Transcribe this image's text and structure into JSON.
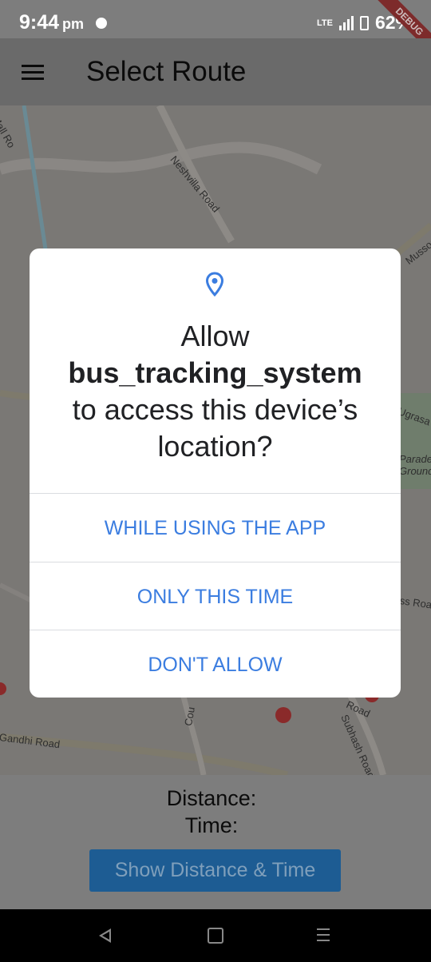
{
  "status_bar": {
    "time": "9:44",
    "ampm": "pm",
    "network": "LTE",
    "battery": "62%",
    "debug": "DEBUG"
  },
  "app_bar": {
    "title": "Select Route"
  },
  "map": {
    "labels": [
      "Neshvilla Road",
      "Mussoo",
      "Ugrasa",
      "Parade Ground",
      "Subhash Road",
      "Gandhi Road",
      "Mall Ro",
      "ss Roa",
      "Road",
      "Cou"
    ]
  },
  "dialog": {
    "title_prefix": "Allow",
    "app_name": "bus_tracking_system",
    "title_suffix": "to access this device’s location?",
    "options": [
      "WHILE USING THE APP",
      "ONLY THIS TIME",
      "DON'T ALLOW"
    ]
  },
  "bottom_panel": {
    "distance_label": "Distance:",
    "time_label": "Time:",
    "button_label": "Show Distance & Time"
  },
  "colors": {
    "accent": "#3b7de0",
    "scrim": "#7d7d7d",
    "button": "#1d5c93"
  }
}
